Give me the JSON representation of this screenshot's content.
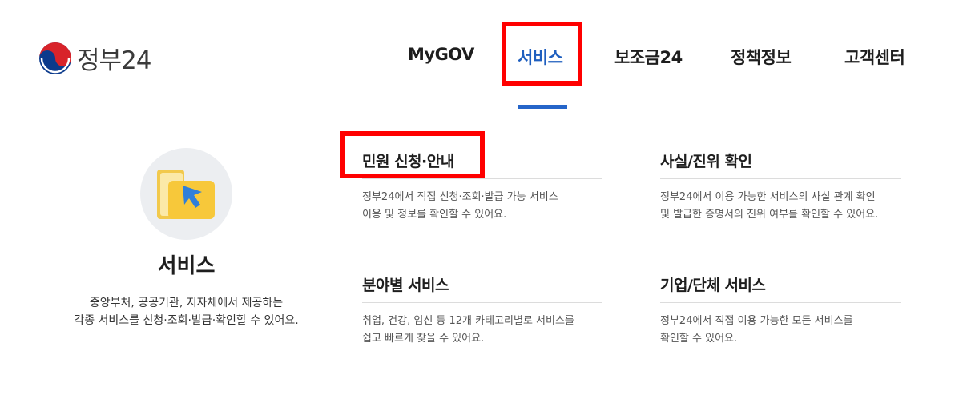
{
  "header": {
    "logo_text": "정부24",
    "nav": [
      {
        "label": "MyGOV"
      },
      {
        "label": "서비스"
      },
      {
        "label": "보조금24"
      },
      {
        "label": "정책정보"
      },
      {
        "label": "고객센터"
      }
    ]
  },
  "intro": {
    "icon": "folder-cursor-icon",
    "title": "서비스",
    "desc_line1": "중앙부처, 공공기관, 지자체에서 제공하는",
    "desc_line2": "각종 서비스를 신청·조회·발급·확인할 수 있어요."
  },
  "menu": [
    {
      "title": "민원 신청·안내",
      "desc_line1": "정부24에서 직접 신청·조회·발급 가능 서비스",
      "desc_line2": "이용 및 정보를 확인할 수 있어요."
    },
    {
      "title": "사실/진위 확인",
      "desc_line1": "정부24에서 이용 가능한 서비스의 사실 관계 확인",
      "desc_line2": "및 발급한 증명서의 진위 여부를 확인할 수 있어요."
    },
    {
      "title": "분야별 서비스",
      "desc_line1": "취업, 건강, 임신 등 12개 카테고리별로 서비스를",
      "desc_line2": "쉽고 빠르게 찾을 수 있어요."
    },
    {
      "title": "기업/단체 서비스",
      "desc_line1": "정부24에서 직접 이용 가능한 모든 서비스를",
      "desc_line2": "확인할 수 있어요."
    }
  ],
  "colors": {
    "active_nav": "#1f5fbf",
    "highlight_box": "#ff0000"
  }
}
